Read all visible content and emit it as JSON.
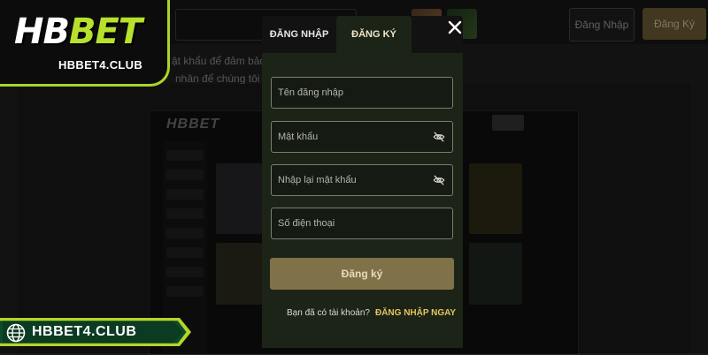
{
  "brand": {
    "logo_part1": "HB",
    "logo_part2": "BET",
    "subtitle": "HBBET4.CLUB",
    "accent_color": "#b7e12c"
  },
  "domain_ribbon": {
    "text": "HBBET4.CLUB",
    "icon": "globe-icon"
  },
  "background_page": {
    "login_button": "Đăng Nhập",
    "register_button": "Đăng Ký",
    "text_line_1": "ật khẩu để đảm bảo c",
    "text_line_2": "nhân để chúng tôi có"
  },
  "modal": {
    "tabs": [
      {
        "label": "ĐĂNG NHẬP",
        "active": false
      },
      {
        "label": "ĐĂNG KÝ",
        "active": true
      }
    ],
    "close_icon": "close-icon",
    "fields": {
      "username": {
        "placeholder": "Tên đăng nhập",
        "value": ""
      },
      "password": {
        "placeholder": "Mật khẩu",
        "value": "",
        "icon": "eye-off-icon"
      },
      "confirm_password": {
        "placeholder": "Nhập lại mật khẩu",
        "value": "",
        "icon": "eye-off-icon"
      },
      "phone": {
        "placeholder": "Số điện thoại",
        "value": ""
      }
    },
    "submit_label": "Đăng ký",
    "switch_question": "Bạn đã có tài khoản?",
    "switch_link": "ĐĂNG NHẬP NGAY",
    "submit_color": "#807248",
    "link_color": "#e6c35c"
  }
}
